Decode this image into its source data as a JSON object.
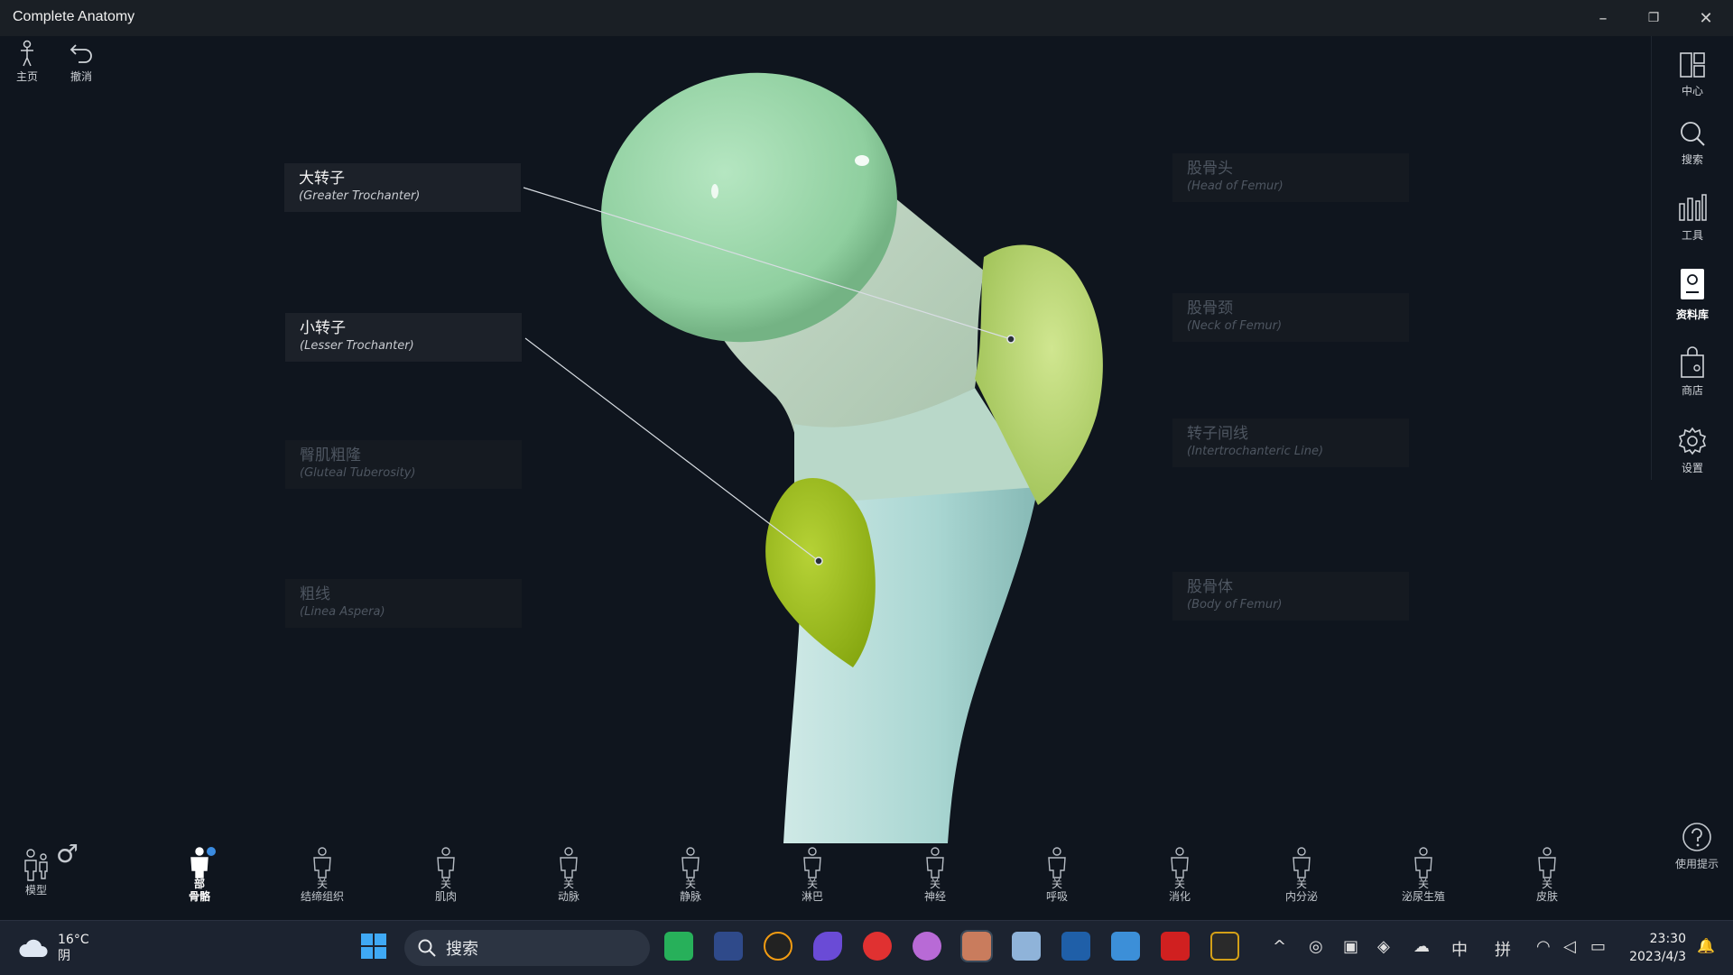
{
  "window": {
    "title": "Complete Anatomy",
    "minimize": "–",
    "restore": "❐",
    "close": "✕"
  },
  "top_tools": [
    {
      "label": "主页"
    },
    {
      "label": "撤消"
    }
  ],
  "right_panel": [
    {
      "label": "中心",
      "icon": "layout-icon"
    },
    {
      "label": "搜索",
      "icon": "search-icon"
    },
    {
      "label": "工具",
      "icon": "tools-icon"
    },
    {
      "label": "资料库",
      "icon": "library-icon",
      "active": true
    },
    {
      "label": "商店",
      "icon": "shop-icon"
    },
    {
      "label": "设置",
      "icon": "gear-icon"
    }
  ],
  "labels_left": [
    {
      "zh": "大转子",
      "en": "(Greater Trochanter)",
      "active": true
    },
    {
      "zh": "小转子",
      "en": "(Lesser Trochanter)",
      "active": true
    },
    {
      "zh": "臀肌粗隆",
      "en": "(Gluteal Tuberosity)",
      "active": false
    },
    {
      "zh": "粗线",
      "en": "(Linea Aspera)",
      "active": false
    }
  ],
  "labels_right": [
    {
      "zh": "股骨头",
      "en": "(Head of Femur)",
      "active": false
    },
    {
      "zh": "股骨颈",
      "en": "(Neck of Femur)",
      "active": false
    },
    {
      "zh": "转子间线",
      "en": "(Intertrochanteric Line)",
      "active": false
    },
    {
      "zh": "股骨体",
      "en": "(Body of Femur)",
      "active": false
    }
  ],
  "bottom_left": {
    "model_label": "模型",
    "gender_symbol": "♂"
  },
  "systems": [
    {
      "line1": "部",
      "line2": "骨骼",
      "active": true
    },
    {
      "line1": "关",
      "line2": "结缔组织"
    },
    {
      "line1": "关",
      "line2": "肌肉"
    },
    {
      "line1": "关",
      "line2": "动脉"
    },
    {
      "line1": "关",
      "line2": "静脉"
    },
    {
      "line1": "关",
      "line2": "淋巴"
    },
    {
      "line1": "关",
      "line2": "神经"
    },
    {
      "line1": "关",
      "line2": "呼吸"
    },
    {
      "line1": "关",
      "line2": "消化"
    },
    {
      "line1": "关",
      "line2": "内分泌"
    },
    {
      "line1": "关",
      "line2": "泌尿生殖"
    },
    {
      "line1": "关",
      "line2": "皮肤"
    }
  ],
  "help": {
    "label": "使用提示",
    "icon": "help-icon"
  },
  "taskbar": {
    "weather_temp": "16°C",
    "weather_desc": "阴",
    "search_placeholder": "搜索",
    "ime_lang": "中",
    "ime_mode": "拼",
    "time": "23:30",
    "date": "2023/4/3",
    "tray_chevron": "^",
    "bell": "🔔"
  },
  "colors": {
    "head": "#9ed8ab",
    "greater_trochanter": "#b6d672",
    "lesser_trochanter": "#9bbd1e",
    "shaft": "#a9d6d2",
    "neck": "#c3d8c4"
  }
}
